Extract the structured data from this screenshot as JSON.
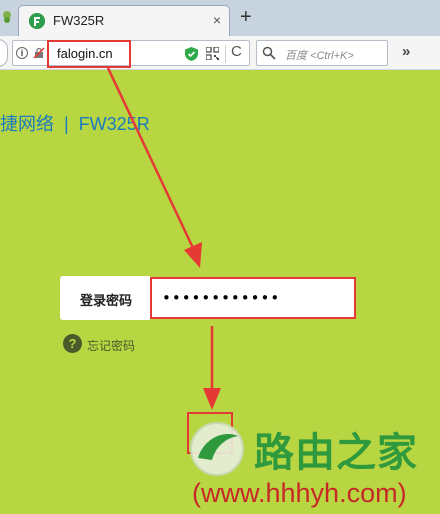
{
  "browser": {
    "tab_title": "FW325R",
    "tab_close": "×",
    "new_tab": "+",
    "url": "falogin.cn",
    "info_glyph": "i",
    "reload_glyph": "C",
    "search_placeholder": "百度 <Ctrl+K>",
    "more_glyph": "»"
  },
  "page": {
    "brand_text": "捷网络",
    "brand_separator": "|",
    "model": "FW325R",
    "password_label": "登录密码",
    "password_value": "••••••••••••",
    "forgot_icon": "?",
    "forgot_label": "忘记密码"
  },
  "watermark": {
    "title": "路由之家",
    "url": "(www.hhhyh.com)"
  },
  "colors": {
    "page_background": "#b8d641",
    "brand_blue": "#1a7bbf",
    "annotation_red": "#e53935",
    "watermark_green": "#2e9a3d"
  },
  "icons": [
    "app-icon",
    "tab-favicon",
    "info-icon",
    "insecure-icon",
    "shield-icon",
    "qr-icon",
    "reload-icon",
    "search-icon",
    "more-icon",
    "help-icon"
  ]
}
